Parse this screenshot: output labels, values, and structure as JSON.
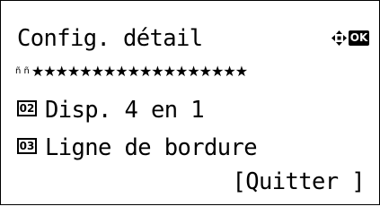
{
  "header": {
    "title": "Config. détail",
    "nav_icon": "four-way-arrow-icon",
    "ok_key": "OK"
  },
  "progress": {
    "lead": "ñ ñ",
    "stars": "★★★★★★★★★★★★★★★★★★"
  },
  "menu": {
    "items": [
      {
        "number": "02",
        "label": "Disp. 4 en 1"
      },
      {
        "number": "03",
        "label": "Ligne de bordure"
      }
    ]
  },
  "footer": {
    "quit_label": "[Quitter ]"
  }
}
